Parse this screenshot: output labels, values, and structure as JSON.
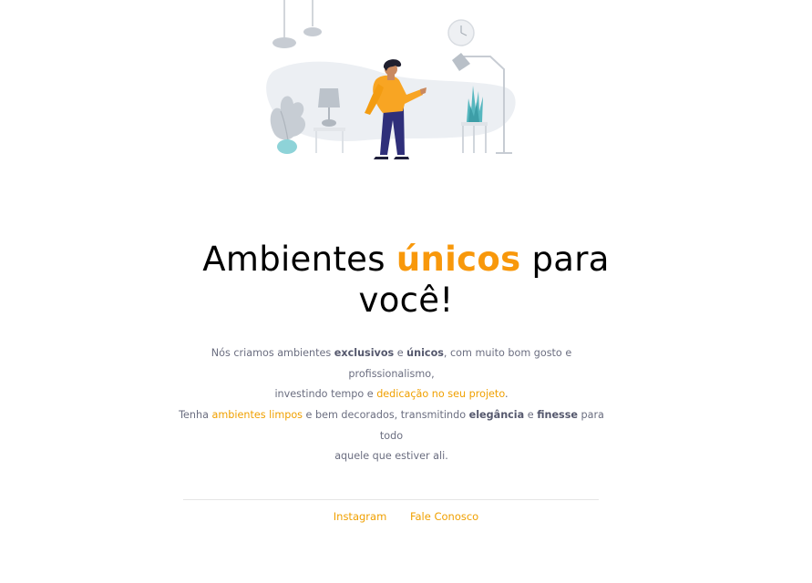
{
  "colors": {
    "accent": "#f8980b",
    "link": "#f0a000",
    "body_text": "#6b6e80",
    "divider": "#e6e6e6"
  },
  "hero": {
    "icon": "person-in-room-illustration"
  },
  "title": {
    "part1": "Ambientes ",
    "highlight": "únicos",
    "part2": " para",
    "line2": "você!"
  },
  "intro": {
    "t1": "Nós criamos ambientes ",
    "b1": "exclusivos",
    "t2": " e ",
    "b2": "únicos",
    "t3": ", com muito bom gosto e profissionalismo,",
    "t4": "investindo tempo e ",
    "hl1": "dedicação no seu projeto",
    "t5": "."
  },
  "details": {
    "t1": "Tenha ",
    "hl1": "ambientes limpos",
    "t2": " e bem decorados, transmitindo ",
    "b1": "elegância",
    "t3": " e ",
    "b2": "finesse",
    "t4": " para todo",
    "t5": "aquele que estiver ali."
  },
  "footer": {
    "instagram": "Instagram",
    "contact": "Fale Conosco"
  }
}
